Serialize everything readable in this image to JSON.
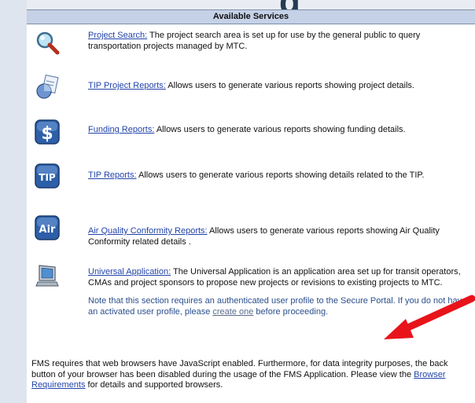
{
  "background_heading": "g",
  "panel_title": "Available Services",
  "services": [
    {
      "link": "Project Search:",
      "desc": " The project search area is set up for use by the general public to query transportation projects managed by MTC.",
      "icon": "magnifier-icon"
    },
    {
      "link": "TIP Project Reports:",
      "desc": " Allows users to generate various reports showing project details.",
      "icon": "report-documents-icon"
    },
    {
      "link": "Funding Reports:",
      "desc": " Allows users to generate various reports showing funding details.",
      "icon": "dollar-icon"
    },
    {
      "link": "TIP Reports:",
      "desc": " Allows users to generate various reports showing details related to the TIP.",
      "icon": "tip-icon"
    },
    {
      "link": "Air Quality Conformity Reports:",
      "desc": " Allows users to generate various reports showing Air Quality Conformity related details .",
      "icon": "air-icon"
    },
    {
      "link": "Universal Application:",
      "desc": " The Universal Application is an application area set up for transit operators, CMAs and project sponsors to propose new projects or revisions to existing projects to MTC.",
      "icon": "computer-icon"
    }
  ],
  "note": {
    "before": "Note that this section requires an authenticated user profile to the Secure Portal. If you do not have an activated user profile, please ",
    "link": "create one",
    "after": " before proceeding."
  },
  "footer": {
    "before": "FMS requires that web browsers have JavaScript enabled. Furthermore, for data integrity purposes, the back button of your browser has been disabled during the usage of the FMS Application. Please view the ",
    "link": "Browser Requirements",
    "after": " for details and supported browsers."
  },
  "colors": {
    "header_bg": "#c5d1e6",
    "link": "#2244aa",
    "note": "#2b4f8c",
    "arrow": "#e8141a"
  }
}
